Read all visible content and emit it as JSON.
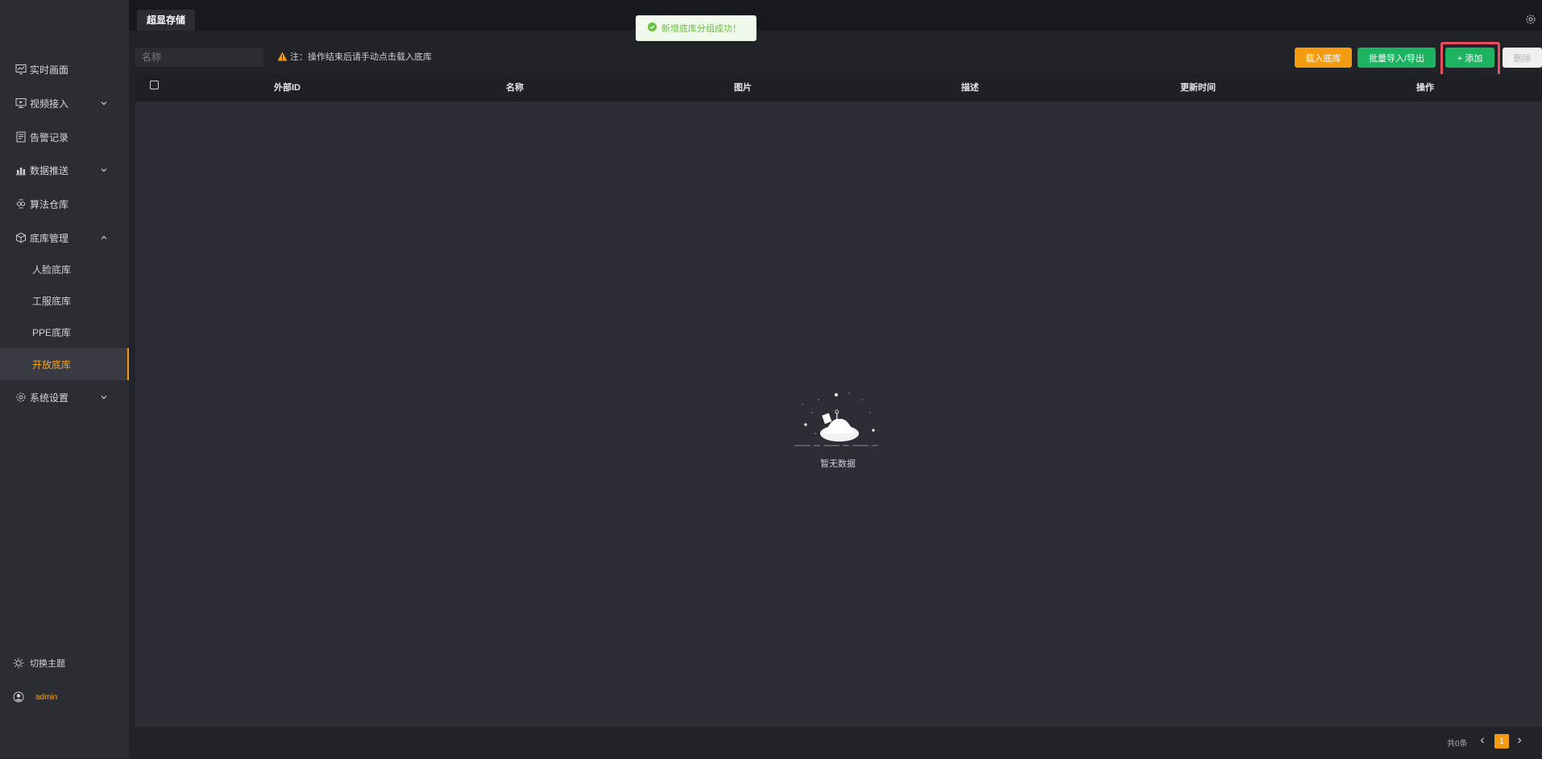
{
  "top": {
    "tab_label": "超显存储"
  },
  "sidebar": {
    "items": [
      {
        "label": "实时画面",
        "icon": "monitor-chart-icon"
      },
      {
        "label": "视频接入",
        "icon": "video-screen-icon"
      },
      {
        "label": "告警记录",
        "icon": "document-list-icon"
      },
      {
        "label": "数据推送",
        "icon": "data-push-icon"
      },
      {
        "label": "算法仓库",
        "icon": "algorithm-icon"
      },
      {
        "label": "底库管理",
        "icon": "cube-icon"
      },
      {
        "label": "系统设置",
        "icon": "gear-icon"
      }
    ],
    "sub_items": [
      {
        "label": "人脸底库"
      },
      {
        "label": "工服底库"
      },
      {
        "label": "PPE底库"
      },
      {
        "label": "开放底库",
        "active": true
      }
    ],
    "theme_label": "切换主题",
    "user_label": "admin"
  },
  "toolbar": {
    "search_placeholder": "名称",
    "note_label": "注：操作结束后请手动点击载入底库",
    "load_label": "载入底库",
    "batch_label": "批量导入/导出",
    "add_label": "+ 添加",
    "delete_label": "删除"
  },
  "table": {
    "columns": [
      "外部ID",
      "名称",
      "图片",
      "描述",
      "更新时间",
      "操作"
    ],
    "empty_text": "暂无数据"
  },
  "toast": {
    "text": "新增底库分组成功！"
  },
  "pager": {
    "total": "共0条",
    "current_page": "1"
  },
  "colors": {
    "accent": "#f39c12",
    "success": "#1db361",
    "highlight": "#e94f5f"
  }
}
